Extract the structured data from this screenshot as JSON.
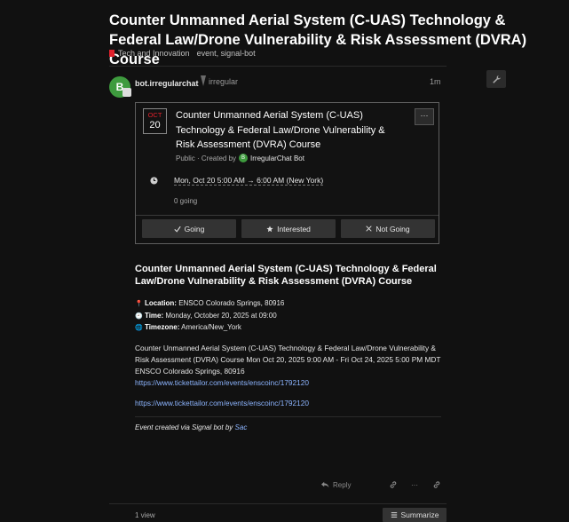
{
  "topic": {
    "title": "Counter Unmanned Aerial System (C-UAS) Technology & Federal Law/Drone Vulnerability & Risk Assessment (DVRA) Course",
    "category": "Tech and Innovation",
    "tags": "event, signal-bot",
    "category_color": "#e0212c"
  },
  "post": {
    "username": "bot.irregularchat",
    "avatar_letter": "B",
    "user_title": "irregular",
    "age": "1m"
  },
  "event": {
    "month": "OCT",
    "day": "20",
    "title": "Counter Unmanned Aerial System (C-UAS) Technology & Federal Law/Drone Vulnerability & Risk Assessment (DVRA) Course",
    "meta_prefix": "Public · Created by",
    "creator_letter": "B",
    "creator": "IrregularChat Bot",
    "menu_label": "···",
    "time": "Mon, Oct 20 5:00 AM → 6:00 AM (New York)",
    "going_count": "0 going",
    "buttons": {
      "going": "Going",
      "interested": "Interested",
      "not_going": "Not Going"
    }
  },
  "body": {
    "heading": "Counter Unmanned Aerial System (C-UAS) Technology & Federal Law/Drone Vulnerability & Risk Assessment (DVRA) Course",
    "location_label": "Location:",
    "location_value": "ENSCO Colorado Springs, 80916",
    "time_label": "Time:",
    "time_value": "Monday, October 20, 2025 at 09:00",
    "timezone_label": "Timezone:",
    "timezone_value": "America/New_York",
    "description": "Counter Unmanned Aerial System (C-UAS) Technology & Federal Law/Drone Vulnerability & Risk Assessment (DVRA) Course Mon Oct 20, 2025 9:00 AM - Fri Oct 24, 2025 5:00 PM MDT",
    "address": "ENSCO Colorado Springs, 80916",
    "link1": "https://www.tickettailor.com/events/enscoinc/1792120",
    "link2": "https://www.tickettailor.com/events/enscoinc/1792120",
    "footnote_prefix": "Event created via Signal bot by",
    "footnote_author": "Sac"
  },
  "actions": {
    "reply": "Reply",
    "more": "···"
  },
  "footer": {
    "views": "1 view",
    "summarize": "Summarize"
  }
}
